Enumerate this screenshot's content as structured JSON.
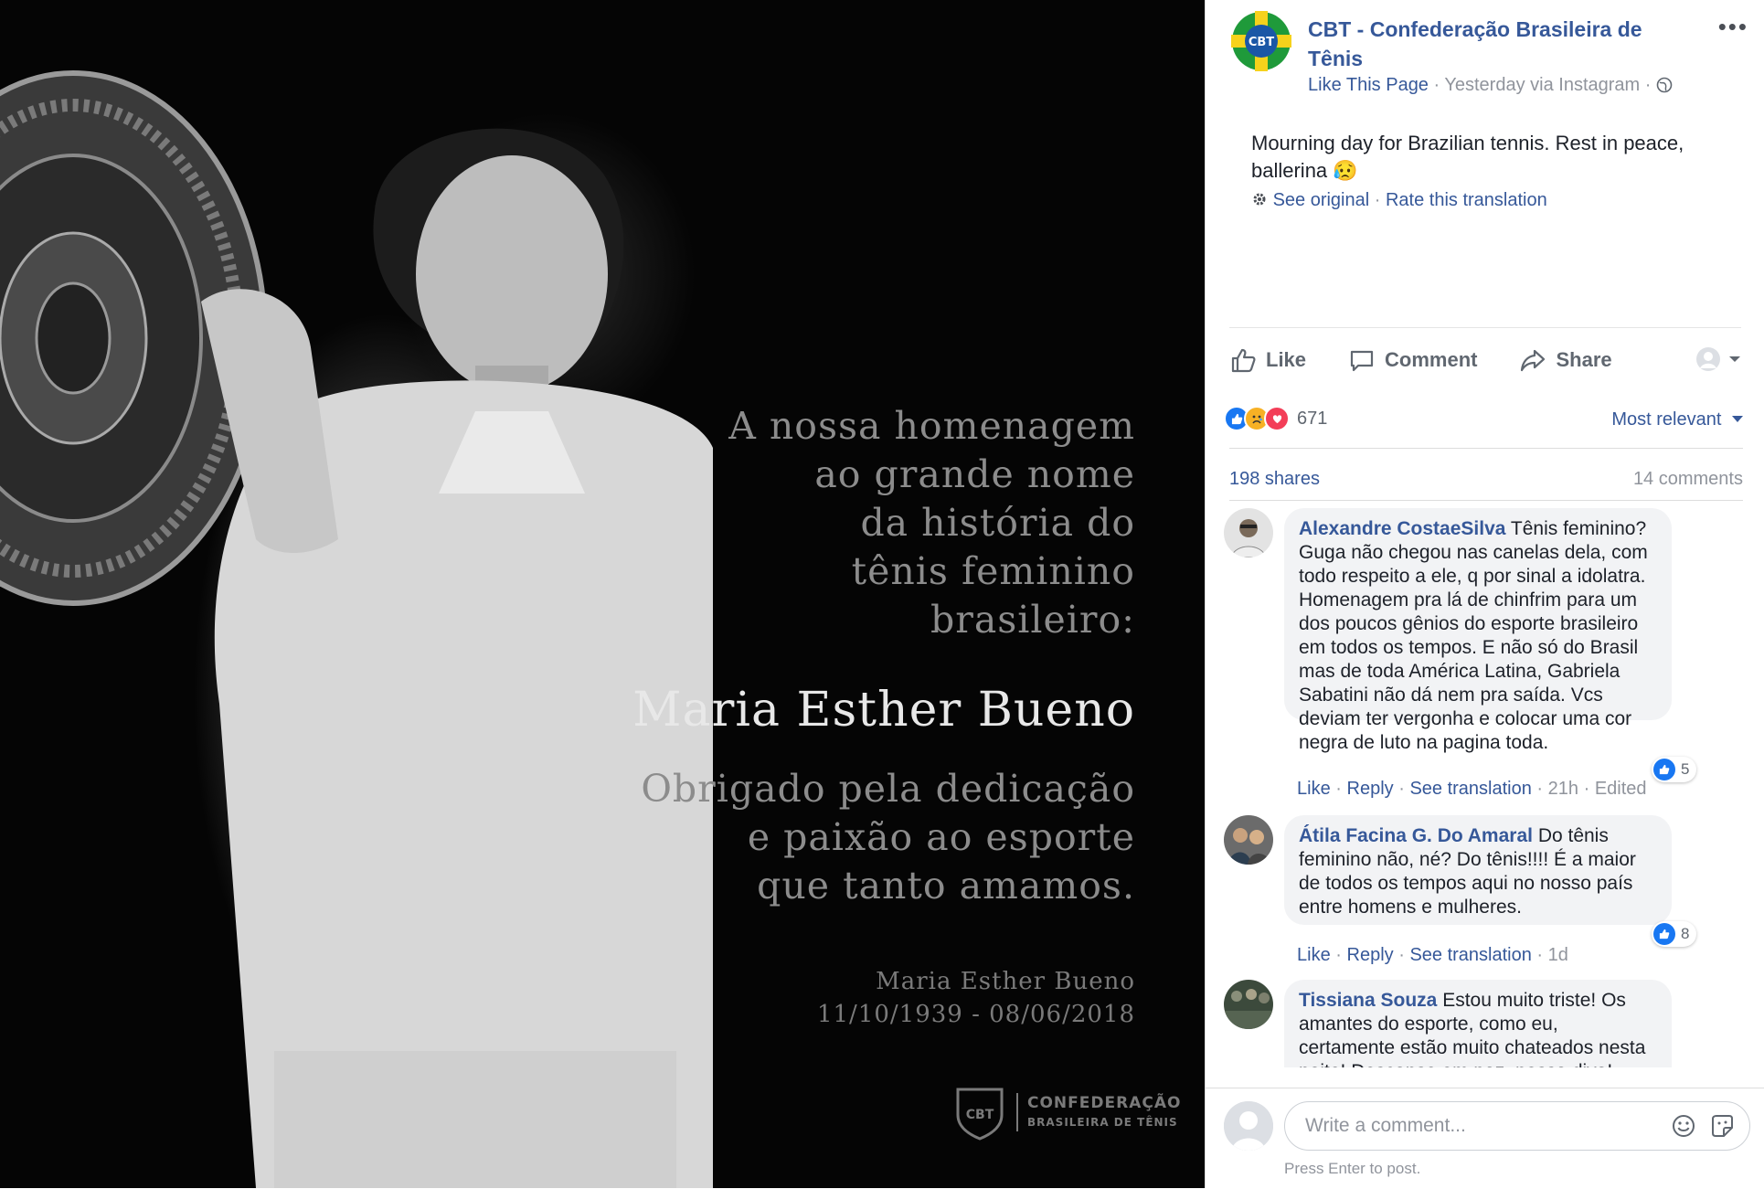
{
  "photo": {
    "tribute_text": "A nossa homenagem\nao grande nome\nda história do\ntênis feminino\nbrasileiro:",
    "honoree": "Maria Esther Bueno",
    "thanks_text": "Obrigado pela dedicação\ne paixão ao esporte\nque tanto amamos.",
    "name_small": "Maria Esther Bueno",
    "dates": "11/10/1939 - 08/06/2018",
    "logo_badge": "CBT",
    "logo_line1": "CONFEDERAÇÃO",
    "logo_line2": "BRASILEIRA DE TÊNIS"
  },
  "post": {
    "page_name": "CBT - Confederação Brasileira de Tênis",
    "avatar_text": "CBT",
    "like_page": "Like This Page",
    "meta_sep": "·",
    "timestamp": "Yesterday via Instagram",
    "more_label": "•••",
    "text": "Mourning day for Brazilian tennis. Rest in peace, ballerina",
    "text_emoji": "😥",
    "see_original": "See original",
    "rate_translation": "Rate this translation",
    "actions": {
      "like": "Like",
      "comment": "Comment",
      "share": "Share"
    },
    "reaction_count": "671",
    "sort_label": "Most relevant",
    "shares": "198 shares",
    "comments_count": "14 comments"
  },
  "comments": [
    {
      "author": "Alexandre CostaeSilva",
      "text": "Tênis feminino? Guga não chegou nas canelas dela, com todo respeito a ele, q por sinal a idolatra. Homenagem pra lá de chinfrim para um dos poucos gênios do esporte brasileiro em todos os tempos. E não só do Brasil mas de toda América Latina, Gabriela Sabatini não dá nem pra saída. Vcs deviam ter vergonha e colocar uma cor negra de luto na pagina toda.",
      "like": "Like",
      "reply": "Reply",
      "see_translation": "See translation",
      "time": "21h",
      "edited": "Edited",
      "likes": "5"
    },
    {
      "author": "Átila Facina G. Do Amaral",
      "text": "Do tênis feminino não, né? Do tênis!!!! É a maior de todos os tempos aqui no nosso país entre homens e mulheres.",
      "like": "Like",
      "reply": "Reply",
      "see_translation": "See translation",
      "time": "1d",
      "likes": "8"
    },
    {
      "author": "Tissiana Souza",
      "text": "Estou muito triste! Os amantes do esporte, como eu, certamente estão muito chateados nesta noite! Descanse em paz, nossa diva!"
    }
  ],
  "composer": {
    "placeholder": "Write a comment...",
    "hint": "Press Enter to post."
  },
  "colors": {
    "link": "#365899",
    "like_blue": "#1877f2",
    "love_red": "#f33e58",
    "sad_yellow": "#f7b125",
    "brand_green": "#1f9a3a",
    "brand_yellow": "#f6d21c"
  }
}
